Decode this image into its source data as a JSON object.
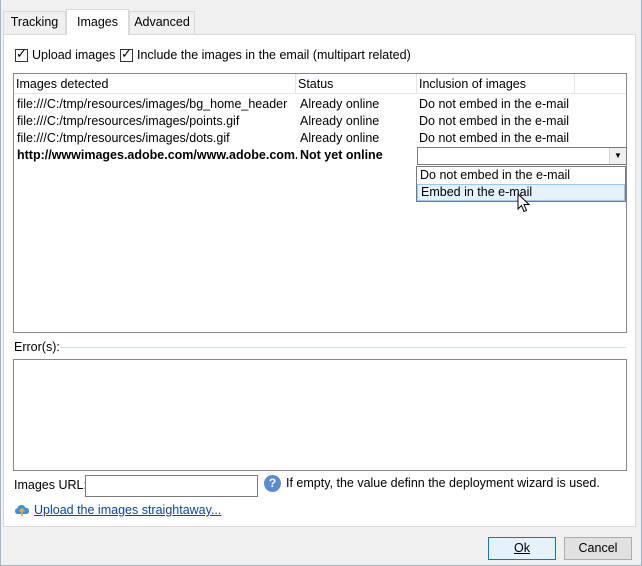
{
  "tabs": [
    {
      "label": "Tracking"
    },
    {
      "label": "Images"
    },
    {
      "label": "Advanced"
    }
  ],
  "options": {
    "upload_images": {
      "label": "Upload images",
      "checked": true
    },
    "include_images": {
      "label": "Include the images in the email (multipart related)",
      "checked": true
    }
  },
  "list": {
    "columns": [
      "Images detected",
      "Status",
      "Inclusion of images"
    ],
    "rows": [
      {
        "image": "file:///C:/tmp/resources/images/bg_home_header",
        "status": "Already online",
        "inclusion": "Do not embed in the e-mail"
      },
      {
        "image": "file:///C:/tmp/resources/images/points.gif",
        "status": "Already online",
        "inclusion": "Do not embed in the e-mail"
      },
      {
        "image": "file:///C:/tmp/resources/images/dots.gif",
        "status": "Already online",
        "inclusion": "Do not embed in the e-mail"
      },
      {
        "image": "http://wwwimages.adobe.com/www.adobe.com...",
        "status": "Not yet online",
        "inclusion": ""
      }
    ],
    "dropdown_options": [
      "Do not embed in the e-mail",
      "Embed in the e-mail"
    ]
  },
  "errors": {
    "label": "Error(s):"
  },
  "images_url": {
    "label": "Images URL:",
    "value": "",
    "help_text": "If empty, the value definn the deployment wizard is used."
  },
  "upload_link": "Upload the images straightaway...",
  "buttons": {
    "ok": "Ok",
    "cancel": "Cancel"
  }
}
